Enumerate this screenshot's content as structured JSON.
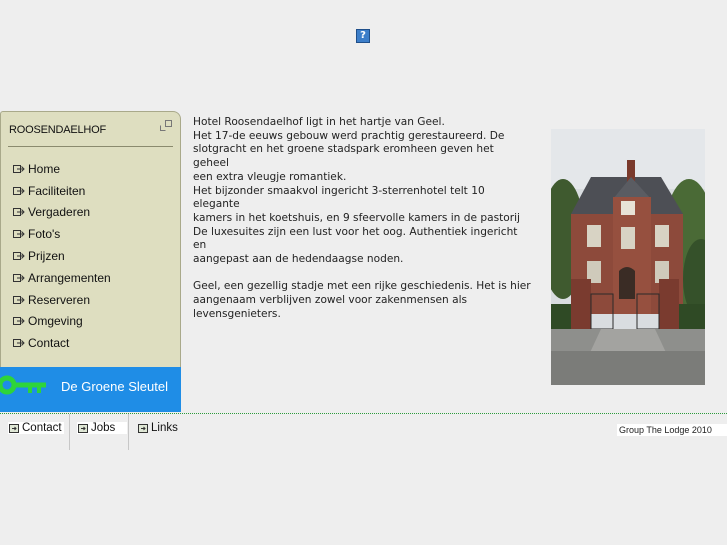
{
  "top_icon": {
    "name": "help-icon",
    "glyph": "?"
  },
  "sidebar": {
    "title": "ROOSENDAELHOF",
    "menu": [
      {
        "label": "Home"
      },
      {
        "label": "Faciliteiten"
      },
      {
        "label": "Vergaderen"
      },
      {
        "label": "Foto's"
      },
      {
        "label": "Prijzen"
      },
      {
        "label": "Arrangementen"
      },
      {
        "label": "Reserveren"
      },
      {
        "label": "Omgeving"
      },
      {
        "label": "Contact"
      }
    ],
    "banner": {
      "label": "De Groene Sleutel",
      "color": "#1f8de6",
      "key_color": "#2ed43a"
    }
  },
  "content": {
    "lines_1": [
      "Hotel Roosendaelhof ligt in het hartje van Geel.",
      "Het 17-de eeuws gebouw werd prachtig gerestaureerd. De",
      "slotgracht en het groene stadspark eromheen geven het geheel",
      "een extra vleugje romantiek.",
      "Het bijzonder smaakvol ingericht 3-sterrenhotel telt 10 elegante",
      "kamers in het koetshuis, en 9 sfeervolle kamers in de pastorij",
      "De luxesuites zijn een lust voor het oog. Authentiek ingericht en",
      "aangepast aan de hedendaagse noden."
    ],
    "lines_2": [
      "Geel, een gezellig stadje met een rijke geschiedenis. Het is hier",
      "aangenaam verblijven zowel voor zakenmensen als",
      "levensgenieters."
    ]
  },
  "photo": {
    "name": "hotel-photo"
  },
  "footer": {
    "tabs": [
      {
        "label": "Contact"
      },
      {
        "label": "Jobs"
      },
      {
        "label": "Links"
      }
    ],
    "copyright": "Group The Lodge 2010"
  }
}
